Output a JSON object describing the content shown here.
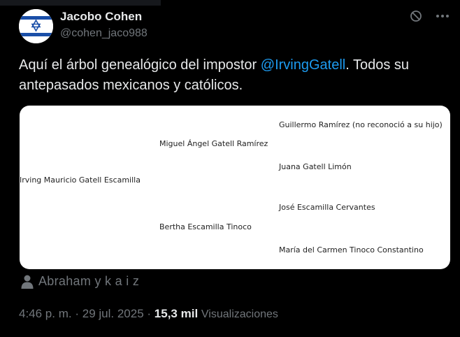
{
  "author": {
    "name": "Jacobo Cohen",
    "handle": "@cohen_jaco988",
    "avatar_icon": "israel-flag-icon"
  },
  "header_icons": {
    "block": "block-icon",
    "more": "more-icon"
  },
  "tweet": {
    "text_before": "Aquí el árbol genealógico del impostor ",
    "mention": "@IrvingGatell",
    "text_after": ". Todos su antepasados mexicanos y católicos."
  },
  "tree": {
    "root": "Irving Mauricio Gatell Escamilla",
    "father": "Miguel Ángel Gatell Ramírez",
    "mother": "Bertha Escamilla Tinoco",
    "paternal_grandfather": "Guillermo Ramírez (no reconoció a su hijo)",
    "paternal_grandmother": "Juana Gatell Limón",
    "maternal_grandfather": "José Escamilla Cervantes",
    "maternal_grandmother": "María del Carmen Tinoco Constantino"
  },
  "tagged": {
    "icon": "person-icon",
    "text": "Abraham y k a i z"
  },
  "meta": {
    "time": "4:46 p. m.",
    "sep1": "·",
    "date": "29 jul. 2025",
    "sep2": "·",
    "views_count": "15,3 mil",
    "views_label": "Visualizaciones"
  },
  "colors": {
    "background": "#000000",
    "text": "#e7e9ea",
    "muted": "#71767b",
    "link": "#1d9bf0"
  }
}
